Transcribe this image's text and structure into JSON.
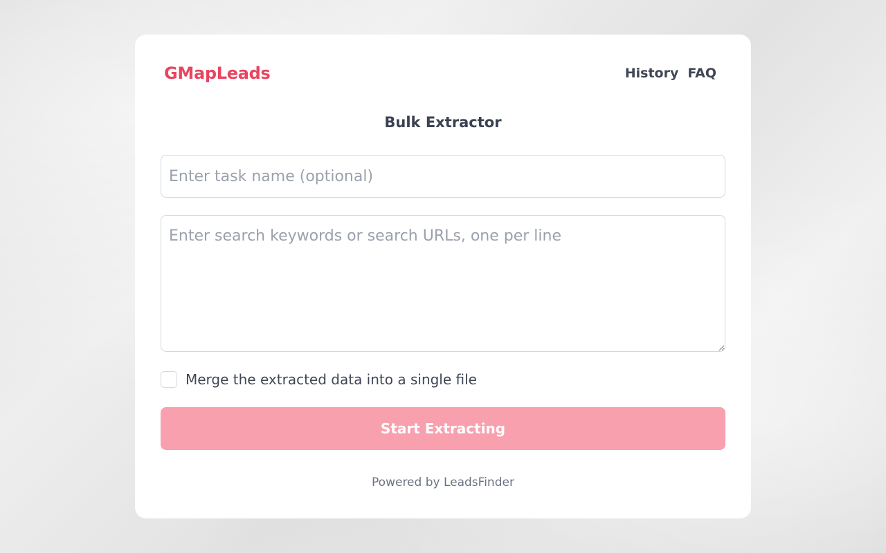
{
  "header": {
    "logo": "GMapLeads",
    "nav": [
      "History",
      "FAQ"
    ]
  },
  "form": {
    "title": "Bulk Extractor",
    "task_name": {
      "placeholder": "Enter task name (optional)",
      "value": ""
    },
    "keywords": {
      "placeholder": "Enter search keywords or search URLs, one per line",
      "value": ""
    },
    "merge_checkbox": {
      "label": "Merge the extracted data into a single file",
      "checked": false
    },
    "submit_label": "Start Extracting"
  },
  "footer": {
    "text": "Powered by LeadsFinder"
  },
  "colors": {
    "brand": "#e8455f",
    "button_disabled": "#f9a0ae",
    "text_dark": "#3a4252",
    "placeholder": "#9aa1ad"
  }
}
